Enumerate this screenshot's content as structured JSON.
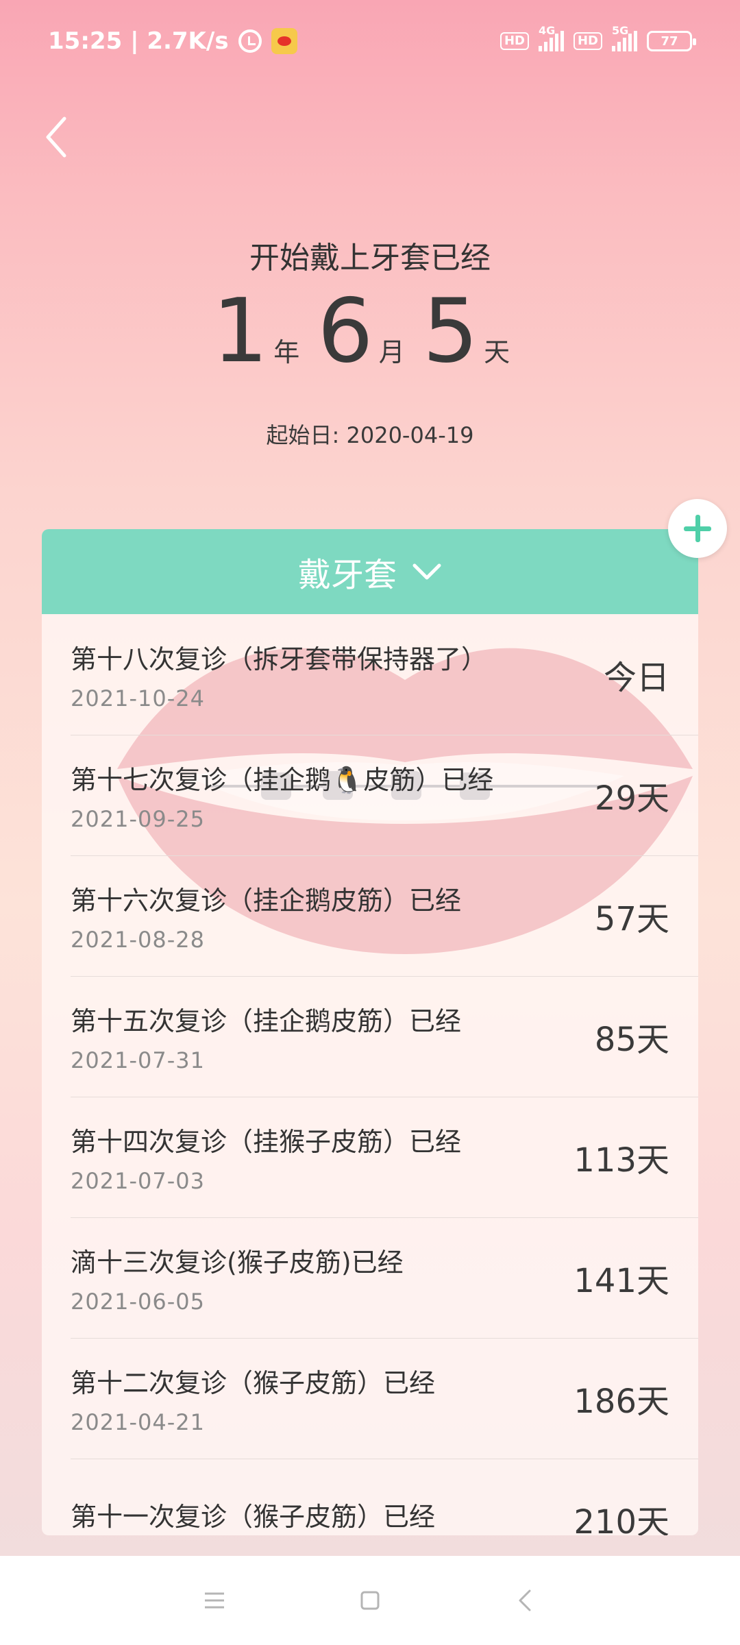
{
  "status_bar": {
    "time_speed": "15:25 | 2.7K/s",
    "hd1": "HD",
    "net1": "4G",
    "hd2": "HD",
    "net2": "5G",
    "battery": "77"
  },
  "header": {
    "title": "开始戴上牙套已经",
    "years": "1",
    "years_unit": "年",
    "months": "6",
    "months_unit": "月",
    "days": "5",
    "days_unit": "天",
    "start_date": "起始日: 2020-04-19"
  },
  "card": {
    "title": "戴牙套",
    "items": [
      {
        "title": "第十八次复诊（拆牙套带保持器了）",
        "date": "2021-10-24",
        "value": "今日"
      },
      {
        "title": "第十七次复诊（挂企鹅🐧皮筋）已经",
        "date": "2021-09-25",
        "value": "29天"
      },
      {
        "title": "第十六次复诊（挂企鹅皮筋）已经",
        "date": "2021-08-28",
        "value": "57天"
      },
      {
        "title": "第十五次复诊（挂企鹅皮筋）已经",
        "date": "2021-07-31",
        "value": "85天"
      },
      {
        "title": "第十四次复诊（挂猴子皮筋）已经",
        "date": "2021-07-03",
        "value": "113天"
      },
      {
        "title": "滴十三次复诊(猴子皮筋)已经",
        "date": "2021-06-05",
        "value": "141天"
      },
      {
        "title": "第十二次复诊（猴子皮筋）已经",
        "date": "2021-04-21",
        "value": "186天"
      },
      {
        "title": "第十一次复诊（猴子皮筋）已经",
        "date": "",
        "value": "210天"
      }
    ]
  },
  "colors": {
    "accent": "#7ed9c1",
    "plus": "#4fcfa8"
  }
}
